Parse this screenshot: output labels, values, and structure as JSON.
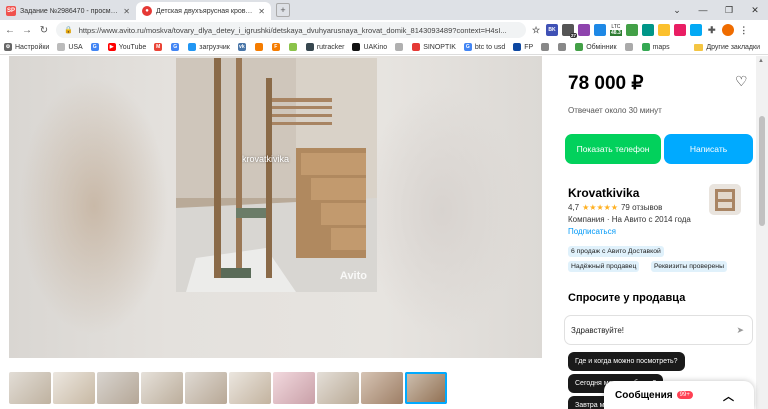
{
  "tabs": [
    {
      "title": "Задание №2986470 - просмотр з",
      "favicon_text": "SP",
      "favicon_color": "#f0524d",
      "active": false
    },
    {
      "title": "Детская двухъярусная кровать д",
      "favicon_text": "",
      "favicon_color": "#e53935",
      "active": true
    }
  ],
  "toolbar": {
    "url": "https://www.avito.ru/moskva/tovary_dlya_detey_i_igrushki/detskaya_dvuhyarusnaya_krovat_domik_8143093489?context=H4sI..."
  },
  "extensions": [
    {
      "name": "bk-ext-icon",
      "text": "BK",
      "color": "#3f51b5"
    },
    {
      "name": "counter-ext-icon",
      "text": "",
      "color": "#555",
      "badge": "27"
    },
    {
      "name": "ext-icon-3",
      "text": "",
      "color": "#8e44ad"
    },
    {
      "name": "ext-icon-4",
      "text": "",
      "color": "#1e88e5"
    },
    {
      "name": "ext-icon-5",
      "text": "",
      "color": "#43a047"
    }
  ],
  "ltc": {
    "label": "LTC",
    "value": "48.3"
  },
  "bookmarks": [
    {
      "label": "Настройки",
      "color": "#555",
      "glyph": "⚙"
    },
    {
      "label": "USA",
      "color": "#999",
      "glyph": ""
    },
    {
      "label": "",
      "color": "#4285f4",
      "glyph": "G"
    },
    {
      "label": "YouTube",
      "color": "#ff0000",
      "glyph": "▶"
    },
    {
      "label": "",
      "color": "#ea4335",
      "glyph": "M"
    },
    {
      "label": "",
      "color": "#4285f4",
      "glyph": "G"
    },
    {
      "label": "загрузчик",
      "color": "#2196f3",
      "glyph": ""
    },
    {
      "label": "",
      "color": "#4a76a8",
      "glyph": "vk"
    },
    {
      "label": "",
      "color": "#f57c00",
      "glyph": ""
    },
    {
      "label": "",
      "color": "#f57c00",
      "glyph": "F"
    },
    {
      "label": "",
      "color": "#8bc34a",
      "glyph": ""
    },
    {
      "label": "rutracker",
      "color": "#37474f",
      "glyph": ""
    },
    {
      "label": "UAKino",
      "color": "#111",
      "glyph": ""
    },
    {
      "label": "",
      "color": "#b0b0b0",
      "glyph": ""
    },
    {
      "label": "SINOPTIK",
      "color": "#e53935",
      "glyph": ""
    },
    {
      "label": "btc to usd",
      "color": "#4285f4",
      "glyph": "G"
    },
    {
      "label": "FP",
      "color": "#0d47a1",
      "glyph": ""
    },
    {
      "label": "",
      "color": "#888",
      "glyph": ""
    },
    {
      "label": "",
      "color": "#888",
      "glyph": ""
    },
    {
      "label": "Обмінник",
      "color": "#43a047",
      "glyph": ""
    },
    {
      "label": "",
      "color": "#aaa",
      "glyph": ""
    },
    {
      "label": "maps",
      "color": "#34a853",
      "glyph": ""
    }
  ],
  "other_bookmarks": "Другие закладки",
  "listing": {
    "price": "78 000 ₽",
    "reply_time": "Отвечает около 30 минут",
    "phone_button": "Показать телефон",
    "write_button": "Написать",
    "seller_name": "Krovatkivika",
    "rating": "4,7",
    "stars": 4.7,
    "reviews": "79 отзывов",
    "company": "Компания · На Авито с 2014 года",
    "subscribe": "Подписаться",
    "chips": [
      "6 продаж с Авито Доставкой",
      "Надёжный продавец",
      "Реквизиты проверены"
    ],
    "ask_title": "Спросите у продавца",
    "ask_input": "Здравствуйте!",
    "questions": [
      "Где и когда можно посмотреть?",
      "Сегодня можно забрать?",
      "Завтра можно"
    ],
    "photo_watermark": "krovatkivika",
    "avito_watermark": "Avito",
    "thumbnail_count": 10,
    "selected_thumbnail": 10
  },
  "messages_widget": {
    "label": "Сообщения",
    "count": "99+"
  },
  "colors": {
    "phone_green": "#02d15c",
    "write_blue": "#00aaff",
    "link": "#0099f7",
    "chip_bg": "#e0f1fb"
  }
}
